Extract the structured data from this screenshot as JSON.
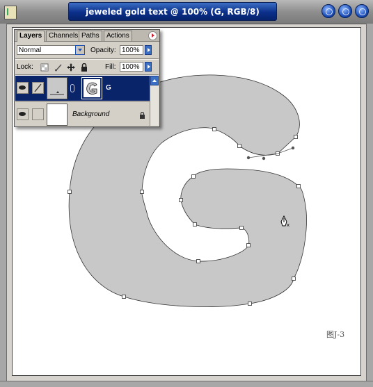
{
  "window": {
    "title": "jeweled gold text @ 100% (G, RGB/8)"
  },
  "layers_panel": {
    "tabs": [
      {
        "label": "Layers",
        "active": true
      },
      {
        "label": "Channels",
        "active": false
      },
      {
        "label": "Paths",
        "active": false
      },
      {
        "label": "Actions",
        "active": false
      }
    ],
    "blend_mode": "Normal",
    "opacity_label": "Opacity:",
    "opacity_value": "100%",
    "lock_label": "Lock:",
    "fill_label": "Fill:",
    "fill_value": "100%",
    "layers": [
      {
        "name": "G",
        "selected": true,
        "visible": true
      },
      {
        "name": "Background",
        "selected": false,
        "visible": true,
        "locked": true
      }
    ]
  },
  "canvas": {
    "figure_label": "图J-3",
    "shape_fill": "#c8c8c8"
  },
  "colors": {
    "title_bar": "#0b2f8a",
    "selected_layer": "#0a246a",
    "panel_bg": "#d4d0c8"
  }
}
